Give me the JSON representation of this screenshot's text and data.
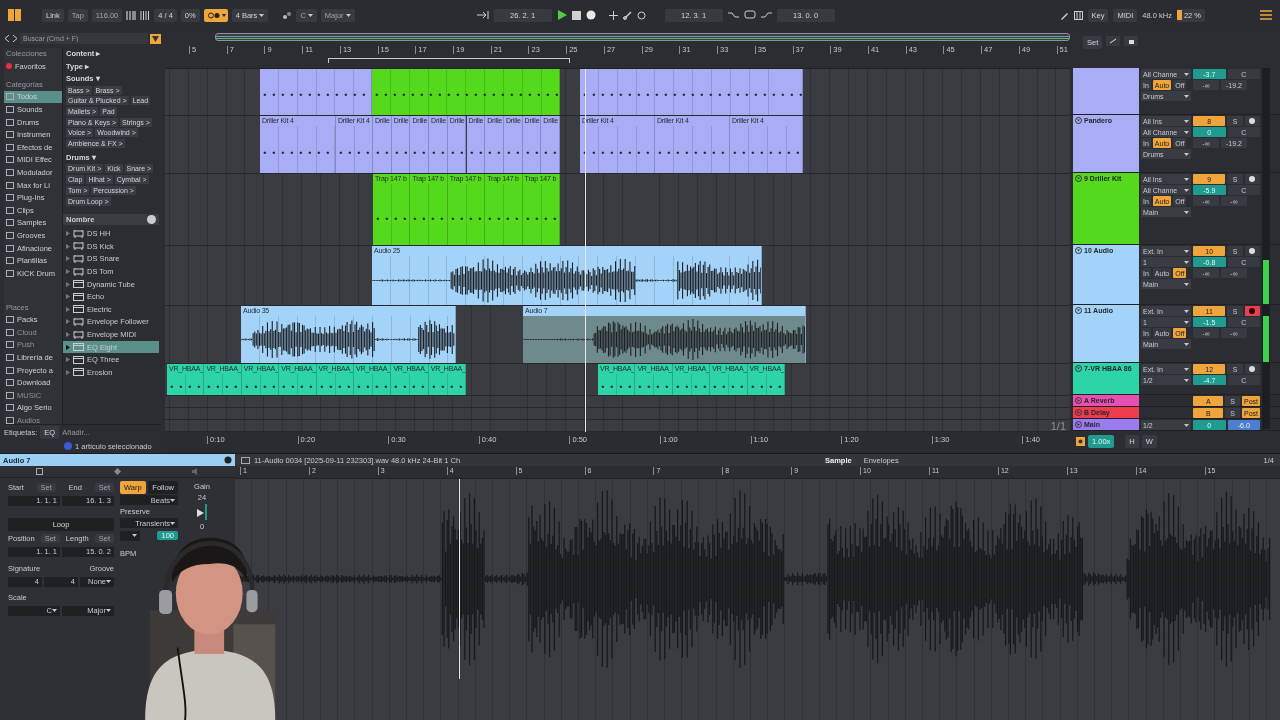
{
  "transport": {
    "link": "Link",
    "tap": "Tap",
    "tempo": "116.00",
    "signature": "4 / 4",
    "groove": "0%",
    "quantize": "4 Bars",
    "key": "C",
    "scale": "Major",
    "position": "26. 2. 1",
    "loop_start": "12. 3. 1",
    "loop_length": "13. 0. 0",
    "key_map": "Key",
    "midi_map": "MIDI",
    "sample_rate": "48.0 kHz",
    "cpu": "22 %"
  },
  "browser": {
    "search_placeholder": "Buscar (Cmd + F)",
    "collections_heading": "Colecciones",
    "favorites": "Favoritos",
    "categories_heading": "Categorías",
    "categories": [
      {
        "label": "Todos",
        "selected": true
      },
      {
        "label": "Sounds",
        "selected": false
      },
      {
        "label": "Drums",
        "selected": false
      },
      {
        "label": "Instrumen",
        "selected": false
      },
      {
        "label": "Efectos de",
        "selected": false
      },
      {
        "label": "MIDI Effec",
        "selected": false
      },
      {
        "label": "Modulador",
        "selected": false
      },
      {
        "label": "Max for Li",
        "selected": false
      },
      {
        "label": "Plug-Ins",
        "selected": false
      },
      {
        "label": "Clips",
        "selected": false
      },
      {
        "label": "Samples",
        "selected": false
      },
      {
        "label": "Grooves",
        "selected": false
      },
      {
        "label": "Afinacione",
        "selected": false
      },
      {
        "label": "Plantillas",
        "selected": false
      },
      {
        "label": "KICK Drum",
        "selected": false
      }
    ],
    "places_heading": "Places",
    "places": [
      {
        "label": "Packs",
        "disabled": false
      },
      {
        "label": "Cloud",
        "disabled": true
      },
      {
        "label": "Push",
        "disabled": true
      },
      {
        "label": "Librería de",
        "disabled": false
      },
      {
        "label": "Proyecto a",
        "disabled": false
      },
      {
        "label": "Download",
        "disabled": false
      },
      {
        "label": "MUSIC",
        "disabled": true
      },
      {
        "label": "Algo Serio",
        "disabled": false
      },
      {
        "label": "Audios",
        "disabled": true
      }
    ],
    "filters": [
      {
        "title": "Content ▸"
      },
      {
        "title": "Type ▸"
      },
      {
        "title": "Sounds ▾",
        "tags": [
          "Bass >",
          "Brass >",
          "Guitar & Plucked >",
          "Lead",
          "Mallets >",
          "Pad",
          "Piano & Keys >",
          "Strings >",
          "Voice >",
          "Woodwind >",
          "Ambience & FX >"
        ]
      },
      {
        "title": "Drums ▾",
        "tags": [
          "Drum Kit >",
          "Kick",
          "Snare >",
          "Clap",
          "Hihat >",
          "Cymbal >",
          "Tom >",
          "Percussion >",
          "Drum Loop >"
        ]
      }
    ],
    "list_header": "Nombre",
    "items": [
      {
        "name": "DS HH",
        "kind": "rack",
        "selected": false
      },
      {
        "name": "DS Kick",
        "kind": "rack",
        "selected": false
      },
      {
        "name": "DS Snare",
        "kind": "rack",
        "selected": false
      },
      {
        "name": "DS Tom",
        "kind": "rack",
        "selected": false
      },
      {
        "name": "Dynamic Tube",
        "kind": "device",
        "selected": false
      },
      {
        "name": "Echo",
        "kind": "device",
        "selected": false
      },
      {
        "name": "Electric",
        "kind": "device",
        "selected": false
      },
      {
        "name": "Envelope Follower",
        "kind": "rack",
        "selected": false
      },
      {
        "name": "Envelope MIDI",
        "kind": "rack",
        "selected": false
      },
      {
        "name": "EQ Eight",
        "kind": "device",
        "selected": true
      },
      {
        "name": "EQ Three",
        "kind": "device",
        "selected": false
      },
      {
        "name": "Erosion",
        "kind": "device",
        "selected": false
      }
    ],
    "tags_label": "Etiquetas:",
    "tag": "EQ",
    "tag_placeholder": "Añadir...",
    "status": "1 artículo seleccionado"
  },
  "arrangement": {
    "set_button": "Set",
    "zoom_label": "1/1",
    "bars": [
      "5",
      "7",
      "9",
      "11",
      "13",
      "15",
      "17",
      "19",
      "21",
      "23",
      "25",
      "27",
      "29",
      "31",
      "33",
      "35",
      "37",
      "39",
      "41",
      "43",
      "45",
      "47",
      "49",
      "51"
    ],
    "times": [
      "0:10",
      "0:20",
      "0:30",
      "0:40",
      "0:50",
      "1:00",
      "1:10",
      "1:20",
      "1:30",
      "1:40"
    ],
    "lanes": [
      {
        "clips": [
          {
            "kind": "midi",
            "color": "#a8adf5",
            "selected": false
          },
          {
            "kind": "midi",
            "color": "#55d91c",
            "selected": false
          },
          {
            "kind": "midi",
            "color": "#a8adf5",
            "selected": false
          }
        ]
      },
      {
        "clips": [
          {
            "kind": "midi",
            "name": "Driller Kit 4",
            "color": "#a8adf5",
            "selected": false
          },
          {
            "kind": "midi",
            "name": "Driller Kit 4",
            "color": "#a8adf5",
            "selected": false
          },
          {
            "kind": "midi",
            "name": "Drille",
            "color": "#a8adf5",
            "selected": false
          },
          {
            "kind": "midi",
            "name": "Drille",
            "color": "#a8adf5",
            "selected": false
          },
          {
            "kind": "midi",
            "name": "Drille",
            "color": "#a8adf5",
            "selected": false
          },
          {
            "kind": "midi",
            "name": "Drille",
            "color": "#a8adf5",
            "selected": false
          },
          {
            "kind": "midi",
            "name": "Drille",
            "color": "#a8adf5",
            "selected": false
          },
          {
            "kind": "midi",
            "name": "Drille",
            "color": "#a8adf5",
            "selected": false
          },
          {
            "kind": "midi",
            "name": "Drille",
            "color": "#a8adf5",
            "selected": false
          },
          {
            "kind": "midi",
            "name": "Drille",
            "color": "#a8adf5",
            "selected": false
          },
          {
            "kind": "midi",
            "name": "Drille",
            "color": "#a8adf5",
            "selected": false
          },
          {
            "kind": "midi",
            "name": "Drille",
            "color": "#a8adf5",
            "selected": false
          },
          {
            "kind": "midi",
            "name": "Driller Kit 4",
            "color": "#a8adf5",
            "selected": false
          },
          {
            "kind": "midi",
            "name": "Driller Kit 4",
            "color": "#a8adf5",
            "selected": false
          },
          {
            "kind": "midi",
            "name": "Driller Kit 4",
            "color": "#a8adf5",
            "selected": false
          }
        ]
      },
      {
        "clips": [
          {
            "kind": "midi",
            "name": "Trap 147 b",
            "color": "#55d91c",
            "selected": false
          },
          {
            "kind": "midi",
            "name": "Trap 147 b",
            "color": "#55d91c",
            "selected": false
          },
          {
            "kind": "midi",
            "name": "Trap 147 b",
            "color": "#55d91c",
            "selected": false
          },
          {
            "kind": "midi",
            "name": "Trap 147 b",
            "color": "#55d91c",
            "selected": false
          },
          {
            "kind": "midi",
            "name": "Trap 147 b",
            "color": "#55d91c",
            "selected": false
          }
        ]
      },
      {
        "clips": [
          {
            "kind": "audio",
            "name": "Audio 25",
            "color": "#a3d3f8",
            "selected": false
          }
        ]
      },
      {
        "clips": [
          {
            "kind": "audio",
            "name": "Audio 35",
            "color": "#a3d3f8",
            "selected": false
          },
          {
            "kind": "audio",
            "name": "Audio 7",
            "color": "#a3d3f8",
            "selected": true
          }
        ]
      },
      {
        "clips": [
          {
            "kind": "midi",
            "name": "VR_HBAA_",
            "color": "#2dd4a7",
            "selected": false
          },
          {
            "kind": "midi",
            "name": "VR_HBAA_",
            "color": "#2dd4a7",
            "selected": false
          },
          {
            "kind": "midi",
            "name": "VR_HBAA_",
            "color": "#2dd4a7",
            "selected": false
          },
          {
            "kind": "midi",
            "name": "VR_HBAA_",
            "color": "#2dd4a7",
            "selected": false
          },
          {
            "kind": "midi",
            "name": "VR_HBAA_",
            "color": "#2dd4a7",
            "selected": false
          },
          {
            "kind": "midi",
            "name": "VR_HBAA_",
            "color": "#2dd4a7",
            "selected": false
          },
          {
            "kind": "midi",
            "name": "VR_HBAA_",
            "color": "#2dd4a7",
            "selected": false
          },
          {
            "kind": "midi",
            "name": "VR_HBAA_",
            "color": "#2dd4a7",
            "selected": false
          },
          {
            "kind": "midi",
            "name": "VR_HBAA_",
            "color": "#2dd4a7",
            "selected": false
          },
          {
            "kind": "midi",
            "name": "VR_HBAA_",
            "color": "#2dd4a7",
            "selected": false
          },
          {
            "kind": "midi",
            "name": "VR_HBAA_",
            "color": "#2dd4a7",
            "selected": false
          },
          {
            "kind": "midi",
            "name": "VR_HBAA_",
            "color": "#2dd4a7",
            "selected": false
          },
          {
            "kind": "midi",
            "name": "VR_HBAA_",
            "color": "#2dd4a7",
            "selected": false
          }
        ]
      }
    ]
  },
  "tracks": [
    {
      "kind": "track",
      "color": "#a8adf5",
      "channel": "All Channe",
      "volume": "-3.7",
      "pan": "C",
      "monitor": [
        {
          "label": "In",
          "selected": false
        },
        {
          "label": "Auto",
          "selected": true
        },
        {
          "label": "Off",
          "selected": false
        }
      ],
      "sends": [
        "-∞",
        "-19.2"
      ],
      "output": "Drums"
    },
    {
      "kind": "track",
      "name": "Pandero",
      "color": "#a8adf5",
      "input": "All Ins",
      "number": "8",
      "solo": "S",
      "channel": "All Channe",
      "volume": "0",
      "pan": "C",
      "monitor": [
        {
          "label": "In",
          "selected": false
        },
        {
          "label": "Auto",
          "selected": true
        },
        {
          "label": "Off",
          "selected": false
        }
      ],
      "sends": [
        "-∞",
        "-19.2"
      ],
      "output": "Drums",
      "armed": false
    },
    {
      "kind": "track",
      "name": "9 Driller Kit",
      "color": "#55d91c",
      "input": "All Ins",
      "number": "9",
      "solo": "S",
      "channel": "All Channe",
      "volume": "-5.9",
      "pan": "C",
      "monitor": [
        {
          "label": "In",
          "selected": false
        },
        {
          "label": "Auto",
          "selected": true
        },
        {
          "label": "Off",
          "selected": false
        }
      ],
      "sends": [
        "-∞",
        "-∞"
      ],
      "output": "Main",
      "armed": false
    },
    {
      "kind": "track",
      "name": "10 Audio",
      "color": "#a3d3f8",
      "input": "Ext. In",
      "number": "10",
      "solo": "S",
      "channel": "1",
      "volume": "-0.8",
      "pan": "C",
      "monitor": [
        {
          "label": "In",
          "selected": false
        },
        {
          "label": "Auto",
          "selected": false
        },
        {
          "label": "Off",
          "selected": true
        }
      ],
      "sends": [
        "-∞",
        "-∞"
      ],
      "output": "Main",
      "armed": false,
      "level": 0.75
    },
    {
      "kind": "track",
      "name": "11 Audio",
      "color": "#a3d3f8",
      "input": "Ext. In",
      "number": "11",
      "solo": "S",
      "channel": "1",
      "volume": "-1.5",
      "pan": "C",
      "monitor": [
        {
          "label": "In",
          "selected": false
        },
        {
          "label": "Auto",
          "selected": false
        },
        {
          "label": "Off",
          "selected": true
        }
      ],
      "sends": [
        "-∞",
        "-∞"
      ],
      "output": "Main",
      "armed": true,
      "level": 0.8
    },
    {
      "kind": "track",
      "name": "7-VR  HBAA  86",
      "color": "#2dd4a7",
      "input": "Ext. In",
      "number": "12",
      "solo": "S",
      "channel": "1/2",
      "volume": "-4.7",
      "pan": "C",
      "armed": false
    },
    {
      "kind": "return",
      "name": "A Reverb",
      "color": "#e84fb2",
      "letter": "A",
      "solo": "S",
      "post": "Post"
    },
    {
      "kind": "return",
      "name": "B Delay",
      "color": "#ef3b4e",
      "letter": "B",
      "solo": "S",
      "post": "Post"
    },
    {
      "kind": "main",
      "name": "Main",
      "color": "#9b7cf0",
      "output": "1/2",
      "volume": "0",
      "pan": "-6.0"
    }
  ],
  "mixer_footer": {
    "tempo_factor": "1.00x",
    "h": "H",
    "w": "W"
  },
  "clip_view": {
    "title": "Audio 7",
    "start_label": "Start",
    "end_label": "End",
    "start_set": "Set",
    "end_set": "Set",
    "position_set": "Set",
    "length_set": "Set",
    "gain": {
      "level": 0.45
    },
    "start": "1. 1. 1",
    "end": "16. 1. 3",
    "loop": "Loop",
    "position_label": "Position",
    "length_label": "Length",
    "position": "1. 1. 1",
    "length": "15. 0. 2",
    "signature_label": "Signature",
    "groove_label": "Groove",
    "sig_num": "4",
    "sig_den": "4",
    "groove": "None",
    "scale_label": "Scale",
    "key": "C",
    "scale": "Major",
    "warp": "Warp",
    "follow": "Follow",
    "warp_mode": "Beats",
    "preserve_label": "Preserve",
    "preserve": "Transients",
    "envelope": "100",
    "bpm_label": "BPM",
    "gain_label": "Gain",
    "gain_max": "24",
    "gain_zero": "0",
    "file_info": "11-Audio 0034 [2025-09-11 232303].wav 48.0 kHz 24-Bit 1 Ch",
    "tabs": [
      {
        "label": "Sample",
        "selected": true
      },
      {
        "label": "Envelopes",
        "selected": false
      }
    ],
    "page": "1/4",
    "ruler": [
      "1",
      "2",
      "3",
      "4",
      "5",
      "6",
      "7",
      "8",
      "9",
      "10",
      "11",
      "12",
      "13",
      "14",
      "15"
    ]
  }
}
